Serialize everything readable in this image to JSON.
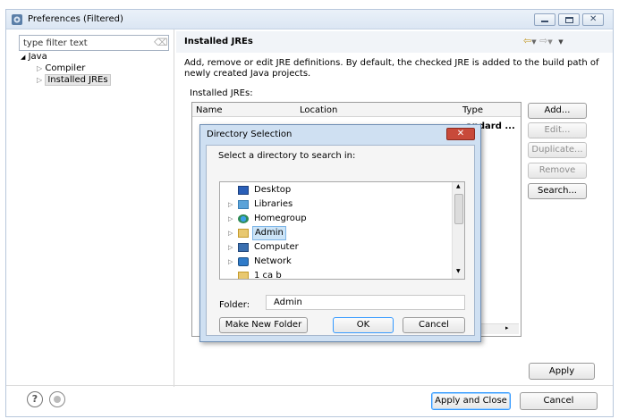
{
  "window": {
    "title": "Preferences (Filtered)"
  },
  "sidebar": {
    "filter_placeholder": "type filter text",
    "tree": {
      "root": "Java",
      "children": [
        "Compiler",
        "Installed JREs"
      ]
    }
  },
  "page": {
    "title": "Installed JREs",
    "description_line1": "Add, remove or edit JRE definitions. By default, the checked JRE is added to the build path of",
    "description_line2": "newly created Java projects.",
    "list_label": "Installed JREs:",
    "columns": [
      "Name",
      "Location",
      "Type"
    ],
    "row_type_fragment": "andard ...",
    "buttons": {
      "add": "Add...",
      "edit": "Edit...",
      "duplicate": "Duplicate...",
      "remove": "Remove",
      "search": "Search..."
    },
    "apply": "Apply"
  },
  "footer": {
    "apply_close": "Apply and Close",
    "cancel": "Cancel"
  },
  "dialog": {
    "title": "Directory Selection",
    "prompt": "Select a directory to search in:",
    "tree": [
      {
        "label": "Desktop",
        "icon": "desktop-icon",
        "expander": false
      },
      {
        "label": "Libraries",
        "icon": "libraries-icon",
        "expander": true
      },
      {
        "label": "Homegroup",
        "icon": "homegroup-icon",
        "expander": true
      },
      {
        "label": "Admin",
        "icon": "user-folder-icon",
        "expander": true,
        "selected": true
      },
      {
        "label": "Computer",
        "icon": "computer-icon",
        "expander": true
      },
      {
        "label": "Network",
        "icon": "network-icon",
        "expander": true
      },
      {
        "label": "1 ca b",
        "icon": "folder-icon",
        "expander": false
      }
    ],
    "folder_label": "Folder:",
    "folder_value": "Admin",
    "buttons": {
      "make_new": "Make New Folder",
      "ok": "OK",
      "cancel": "Cancel"
    }
  },
  "colors": {
    "accent": "#3399ff",
    "close_red": "#c84a3a",
    "selection": "#cce4f7",
    "title_bar": "#dbe6f3"
  }
}
